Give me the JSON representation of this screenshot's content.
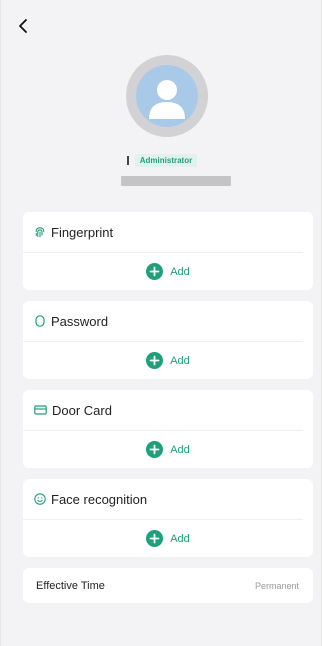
{
  "header": {
    "back_icon": "chevron-left-icon"
  },
  "profile": {
    "role": "Administrator",
    "avatar_icon": "user-avatar-icon"
  },
  "colors": {
    "accent": "#1fa07a",
    "badge_bg": "#dff2ec",
    "background": "#f3f3f5"
  },
  "sections": [
    {
      "title": "Fingerprint",
      "icon": "fingerprint-icon",
      "add_label": "Add"
    },
    {
      "title": "Password",
      "icon": "password-icon",
      "add_label": "Add"
    },
    {
      "title": "Door Card",
      "icon": "card-icon",
      "add_label": "Add"
    },
    {
      "title": "Face recognition",
      "icon": "face-icon",
      "add_label": "Add"
    }
  ],
  "effective_time": {
    "label": "Effective Time",
    "value": "Permanent"
  }
}
